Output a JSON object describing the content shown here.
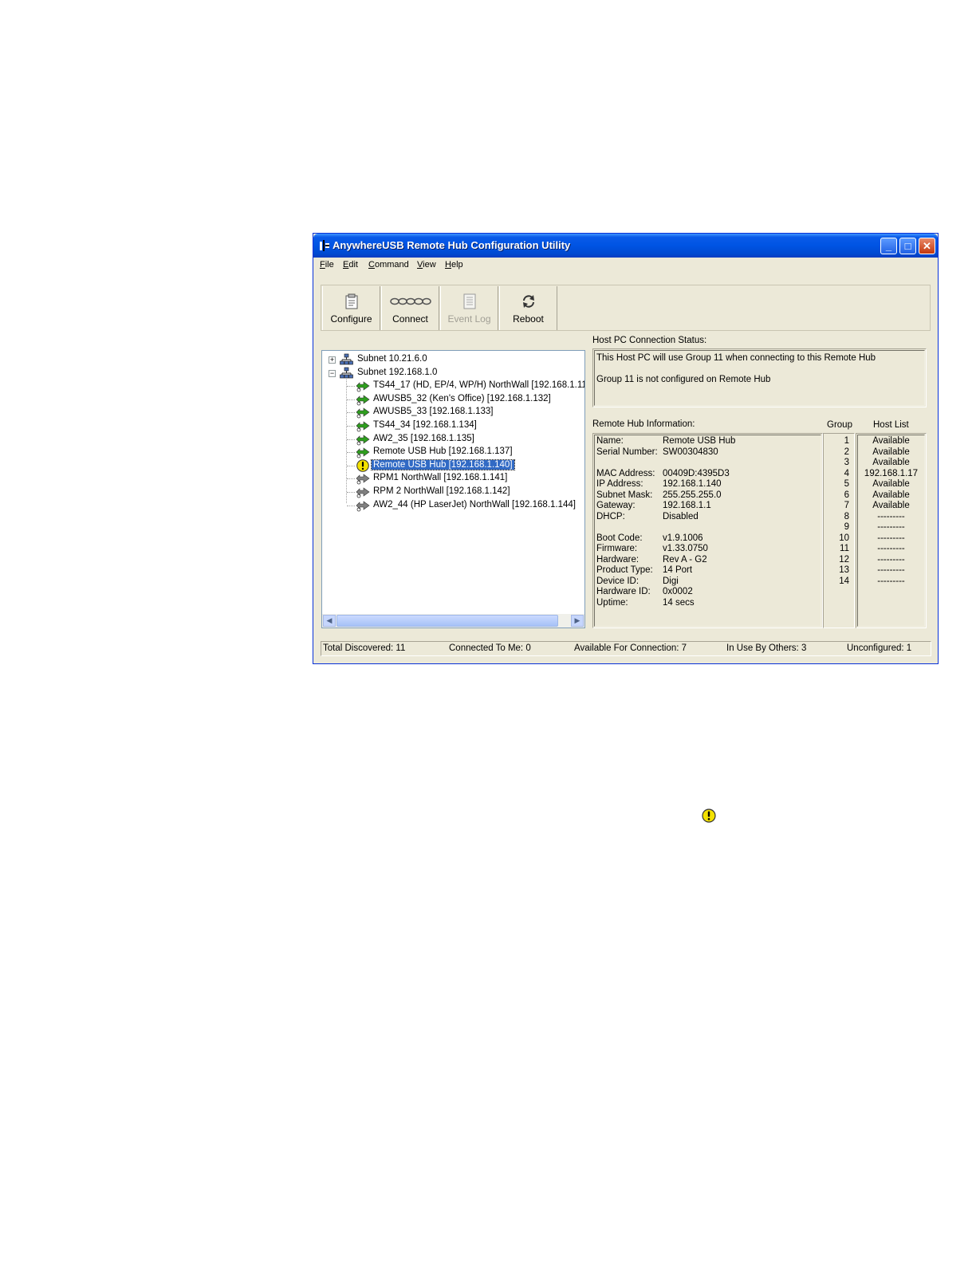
{
  "window": {
    "title": "AnywhereUSB Remote Hub Configuration Utility",
    "controls": {
      "minimize": "_",
      "maximize": "□",
      "close": "✕"
    }
  },
  "menu": [
    {
      "label": "File",
      "accel": "F",
      "rest": "ile"
    },
    {
      "label": "Edit",
      "accel": "E",
      "rest": "dit"
    },
    {
      "label": "Command",
      "accel": "C",
      "rest": "ommand"
    },
    {
      "label": "View",
      "accel": "V",
      "rest": "iew"
    },
    {
      "label": "Help",
      "accel": "H",
      "rest": "elp"
    }
  ],
  "toolbar": {
    "configure": "Configure",
    "connect": "Connect",
    "event_log": "Event Log",
    "reboot": "Reboot"
  },
  "tree": {
    "subnets": [
      {
        "label": "Subnet 10.21.6.0",
        "expanded": false
      },
      {
        "label": "Subnet 192.168.1.0",
        "expanded": true
      }
    ],
    "hubs": [
      {
        "label": "TS44_17 (HD, EP/4, WP/H) NorthWall [192.168.1.11",
        "status": "available"
      },
      {
        "label": "AWUSB5_32 (Ken's Office) [192.168.1.132]",
        "status": "available"
      },
      {
        "label": "AWUSB5_33 [192.168.1.133]",
        "status": "available"
      },
      {
        "label": "TS44_34 [192.168.1.134]",
        "status": "available"
      },
      {
        "label": "AW2_35 [192.168.1.135]",
        "status": "available"
      },
      {
        "label": "Remote USB Hub [192.168.1.137]",
        "status": "available"
      },
      {
        "label": "Remote USB Hub [192.168.1.140]",
        "status": "unconfigured",
        "selected": true
      },
      {
        "label": "RPM1 NorthWall [192.168.1.141]",
        "status": "in-use"
      },
      {
        "label": "RPM 2 NorthWall [192.168.1.142]",
        "status": "in-use"
      },
      {
        "label": "AW2_44 (HP LaserJet) NorthWall [192.168.1.144]",
        "status": "in-use"
      }
    ],
    "scroll_arrows": {
      "left": "◀",
      "right": "▶"
    }
  },
  "host_status": {
    "heading": "Host PC Connection Status:",
    "line1": "This Host PC will use Group 11 when connecting to this Remote Hub",
    "line2": "Group 11 is not configured on Remote Hub"
  },
  "hub_info": {
    "heading": "Remote Hub Information:",
    "group_heading": "Group",
    "host_list_heading": "Host List",
    "rows": [
      {
        "key": "Name:",
        "value": "Remote USB Hub",
        "gap_before": false
      },
      {
        "key": "Serial Number:",
        "value": "SW00304830",
        "gap_before": false
      },
      {
        "key": "MAC Address:",
        "value": "00409D:4395D3",
        "gap_before": true
      },
      {
        "key": "IP Address:",
        "value": "192.168.1.140",
        "gap_before": false
      },
      {
        "key": "Subnet Mask:",
        "value": "255.255.255.0",
        "gap_before": false
      },
      {
        "key": "Gateway:",
        "value": "192.168.1.1",
        "gap_before": false
      },
      {
        "key": "DHCP:",
        "value": "Disabled",
        "gap_before": false
      },
      {
        "key": "Boot Code:",
        "value": "v1.9.1006",
        "gap_before": true
      },
      {
        "key": "Firmware:",
        "value": "v1.33.0750",
        "gap_before": false
      },
      {
        "key": "Hardware:",
        "value": "Rev A - G2",
        "gap_before": false
      },
      {
        "key": "Product Type:",
        "value": "14 Port",
        "gap_before": false
      },
      {
        "key": "Device ID:",
        "value": "Digi",
        "gap_before": false
      },
      {
        "key": "Hardware ID:",
        "value": "0x0002",
        "gap_before": false
      },
      {
        "key": "Uptime:",
        "value": "14 secs",
        "gap_before": false
      }
    ],
    "groups": [
      "1",
      "2",
      "3",
      "4",
      "5",
      "6",
      "7",
      "8",
      "9",
      "10",
      "11",
      "12",
      "13",
      "14"
    ],
    "host_list": [
      "Available",
      "Available",
      "Available",
      "192.168.1.17",
      "Available",
      "Available",
      "Available",
      "---------",
      "---------",
      "---------",
      "---------",
      "---------",
      "---------",
      "---------"
    ]
  },
  "statusbar": {
    "total": "Total Discovered: 11",
    "connected": "Connected To Me: 0",
    "available": "Available For Connection: 7",
    "in_use": "In Use By Others: 3",
    "unconfigured": "Unconfigured: 1"
  },
  "colors": {
    "available": "#2e9e1e",
    "in_use": "#808080",
    "warning": "#f3e100",
    "selection": "#316ac5"
  }
}
